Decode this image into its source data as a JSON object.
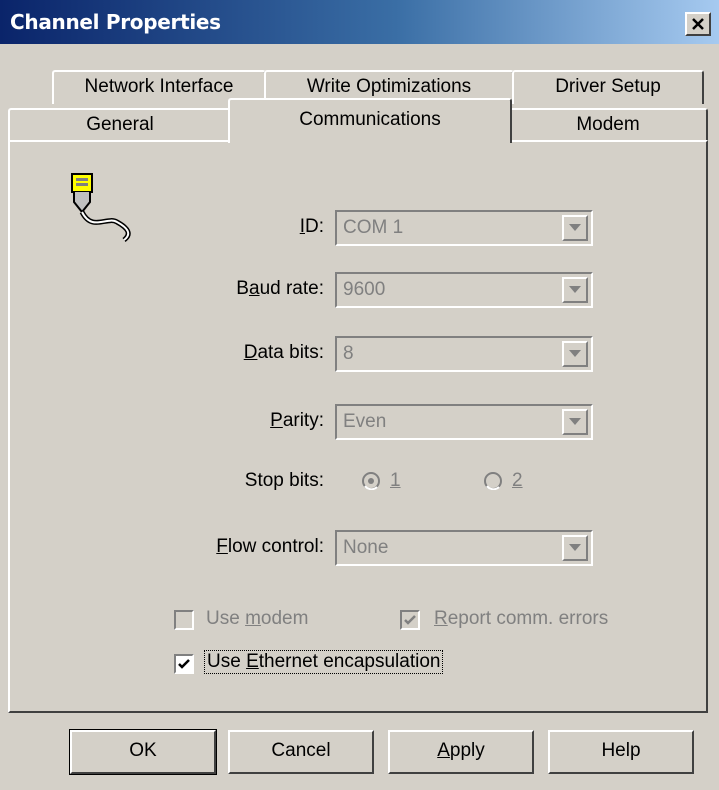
{
  "window": {
    "title": "Channel Properties"
  },
  "tabs_row1": [
    {
      "label": "Network Interface"
    },
    {
      "label": "Write Optimizations"
    },
    {
      "label": "Driver Setup"
    }
  ],
  "tabs_row2": [
    {
      "label": "General"
    },
    {
      "label": "Communications",
      "active": true
    },
    {
      "label": "Modem"
    }
  ],
  "fields": {
    "id": {
      "label_u": "I",
      "label_rest": "D:",
      "value": "COM 1"
    },
    "baud": {
      "label_pre": "B",
      "label_u": "a",
      "label_rest": "ud rate:",
      "value": "9600"
    },
    "data_bits": {
      "label_u": "D",
      "label_rest": "ata bits:",
      "value": "8"
    },
    "parity": {
      "label_u": "P",
      "label_rest": "arity:",
      "value": "Even"
    },
    "stop_bits": {
      "label": "Stop bits:",
      "opt1": "1",
      "opt2": "2",
      "selected": "1"
    },
    "flow": {
      "label_u": "F",
      "label_rest": "low control:",
      "value": "None"
    }
  },
  "checkboxes": {
    "use_modem": {
      "pre": "Use ",
      "u": "m",
      "rest": "odem",
      "checked": false,
      "enabled": false
    },
    "report_errors": {
      "u": "R",
      "rest": "eport comm. errors",
      "checked": true,
      "enabled": false
    },
    "ethernet": {
      "pre": "Use ",
      "u": "E",
      "rest": "thernet encapsulation",
      "checked": true,
      "enabled": true
    }
  },
  "buttons": {
    "ok": "OK",
    "cancel": "Cancel",
    "apply_u": "A",
    "apply_rest": "pply",
    "help": "Help"
  },
  "colors": {
    "title_start": "#0a246a",
    "title_end": "#a6caf0",
    "face": "#d4d0c8",
    "disabled_text": "#808080"
  },
  "icons": {
    "channel": "serial-cable-icon",
    "close": "close-icon"
  }
}
